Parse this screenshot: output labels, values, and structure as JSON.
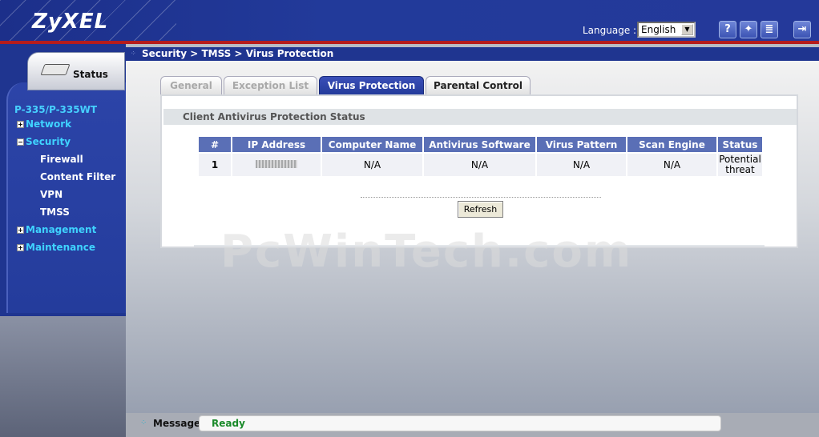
{
  "header": {
    "logo": "ZyXEL",
    "language_label": "Language :",
    "language_value": "English",
    "icons": [
      "help-icon",
      "wizard-icon",
      "notes-icon",
      "logout-icon"
    ]
  },
  "sidebar": {
    "status_label": "Status",
    "model": "P-335/P-335WT",
    "items": [
      {
        "label": "Network",
        "expanded": false
      },
      {
        "label": "Security",
        "expanded": true
      },
      {
        "label": "Management",
        "expanded": false
      },
      {
        "label": "Maintenance",
        "expanded": false
      }
    ],
    "security_subitems": [
      "Firewall",
      "Content Filter",
      "VPN",
      "TMSS"
    ]
  },
  "breadcrumb": "Security > TMSS > Virus Protection",
  "tabs": [
    {
      "label": "General",
      "state": "disabled"
    },
    {
      "label": "Exception List",
      "state": "disabled"
    },
    {
      "label": "Virus Protection",
      "state": "active"
    },
    {
      "label": "Parental Control",
      "state": "normal"
    }
  ],
  "section_title": "Client Antivirus Protection Status",
  "table": {
    "headers": [
      "#",
      "IP Address",
      "Computer Name",
      "Antivirus Software",
      "Virus Pattern",
      "Scan Engine",
      "Status"
    ],
    "rows": [
      {
        "num": "1",
        "computer_name": "N/A",
        "antivirus": "N/A",
        "pattern": "N/A",
        "engine": "N/A",
        "status": "Potential threat"
      }
    ]
  },
  "refresh_label": "Refresh",
  "watermark": "PcWinTech.com",
  "message": {
    "label": "Message",
    "value": "Ready"
  },
  "colors": {
    "brand_blue": "#223a9a",
    "accent_red": "#b51c1c",
    "nav_text": "#3fd3ff",
    "ready_green": "#1a8a2a"
  }
}
